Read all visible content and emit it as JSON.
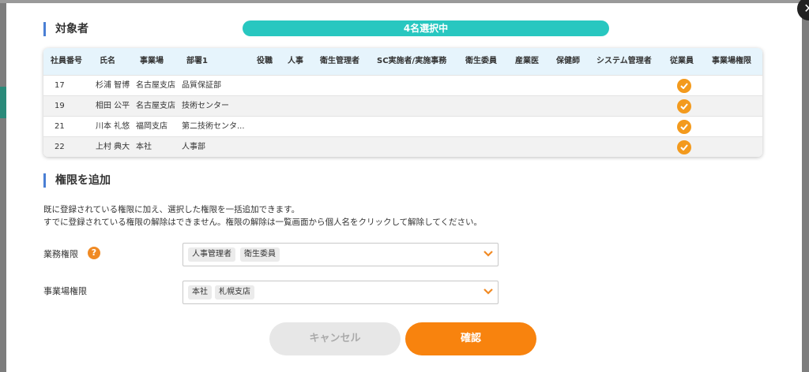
{
  "target_section": {
    "title": "対象者",
    "selected_count": "4名選択中"
  },
  "table": {
    "headers": [
      "社員番号",
      "氏名",
      "事業場",
      "部署1",
      "役職",
      "人事",
      "衛生管理者",
      "SC実施者/実施事務",
      "衛生委員",
      "産業医",
      "保健師",
      "システム管理者",
      "従業員",
      "事業場権限"
    ],
    "rows": [
      {
        "id": "17",
        "name": "杉浦 智博",
        "site": "名古屋支店",
        "dept": "品質保証部",
        "employee": true
      },
      {
        "id": "19",
        "name": "相田 公平",
        "site": "名古屋支店",
        "dept": "技術センター",
        "employee": true
      },
      {
        "id": "21",
        "name": "川本 礼悠",
        "site": "福岡支店",
        "dept": "第二技術センタ...",
        "employee": true
      },
      {
        "id": "22",
        "name": "上村 典大",
        "site": "本社",
        "dept": "人事部",
        "employee": true
      }
    ]
  },
  "add_section": {
    "title": "権限を追加",
    "desc1": "既に登録されている権限に加え、選択した権限を一括追加できます。",
    "desc2": "すでに登録されている権限の解除はできません。権限の解除は一覧画面から個人名をクリックして解除してください。"
  },
  "fields": {
    "business": {
      "label": "業務権限",
      "help": "?",
      "tags": [
        "人事管理者",
        "衛生委員"
      ]
    },
    "site": {
      "label": "事業場権限",
      "tags": [
        "本社",
        "札幌支店"
      ]
    }
  },
  "buttons": {
    "cancel": "キャンセル",
    "confirm": "確認"
  },
  "close_label": "✕",
  "colors": {
    "accent": "#28c7c0",
    "orange": "#f8830e",
    "check": "#f39a1d",
    "title_bar": "#4a7fd4"
  }
}
